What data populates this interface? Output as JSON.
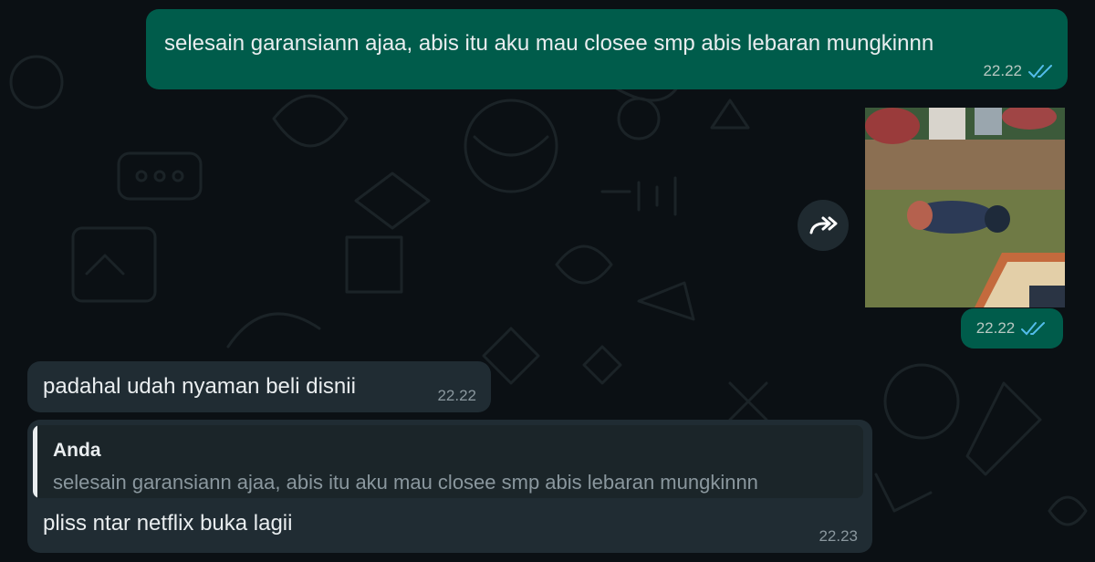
{
  "messages": [
    {
      "id": "msg1",
      "direction": "outgoing",
      "text": "selesain garansiann ajaa, abis itu aku mau closee smp abis lebaran mungkinnn",
      "time": "22.22",
      "status": "read"
    },
    {
      "id": "msg-image",
      "direction": "outgoing",
      "type": "image",
      "time": "22.22",
      "status": "read"
    },
    {
      "id": "msg2",
      "direction": "incoming",
      "text": "padahal udah nyaman beli disnii",
      "time": "22.22"
    },
    {
      "id": "msg3",
      "direction": "incoming",
      "reply_to": {
        "sender": "Anda",
        "text": "selesain garansiann ajaa, abis itu aku mau closee smp abis lebaran mungkinnn"
      },
      "text": "pliss ntar netflix buka lagii",
      "time": "22.23"
    }
  ],
  "icons": {
    "forward": "forward-icon",
    "read_receipt": "double-check-icon"
  },
  "colors": {
    "background": "#0b1014",
    "outgoing_bubble": "#005c4b",
    "incoming_bubble": "#202c33",
    "read_tick": "#53bdeb"
  }
}
